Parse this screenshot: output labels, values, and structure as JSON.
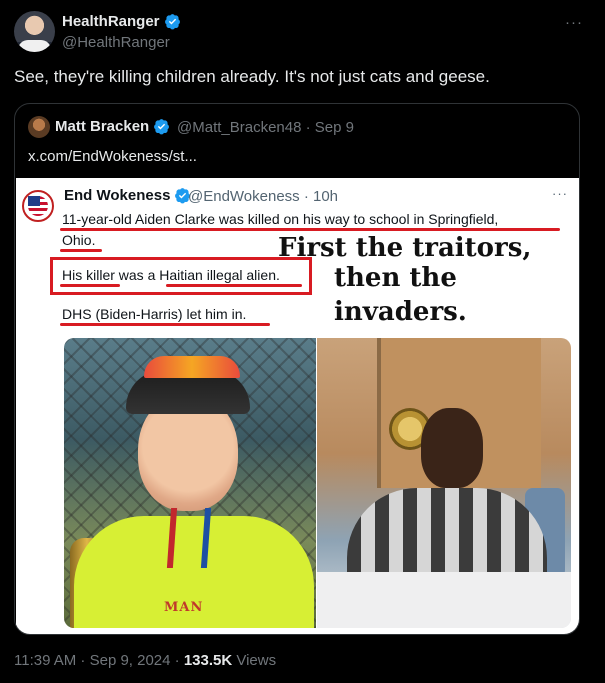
{
  "tweet": {
    "author_name": "HealthRanger",
    "author_handle": "@HealthRanger",
    "more_label": "···",
    "text": "See, they're killing children already. It's not just cats and geese.",
    "timestamp": "11:39 AM · Sep 9, 2024 · ",
    "views_count": "133.5K",
    "views_label": " Views"
  },
  "quote": {
    "author_name": "Matt Bracken",
    "author_handle": "@Matt_Bracken48 · Sep 9",
    "link_text": "x.com/EndWokeness/st..."
  },
  "embedded": {
    "author_name": "End Wokeness",
    "author_handle": "@EndWokeness · 10h",
    "more_label": "···",
    "line1": "11-year-old Aiden Clarke was killed on his way to school in Springfield,",
    "line2": "Ohio.",
    "line3": "His killer was a Haitian illegal alien.",
    "line4": "DHS (Biden-Harris) let him in.",
    "overlay_line1": "First the traitors,",
    "overlay_line2": "then the",
    "overlay_line3": "invaders.",
    "photo_text": "MAN"
  },
  "colors": {
    "background": "#000000",
    "verified": "#1d9bf0",
    "underline_red": "#d81b22"
  },
  "icons": {
    "verified": "verified-badge-icon",
    "more": "more-options-icon"
  }
}
